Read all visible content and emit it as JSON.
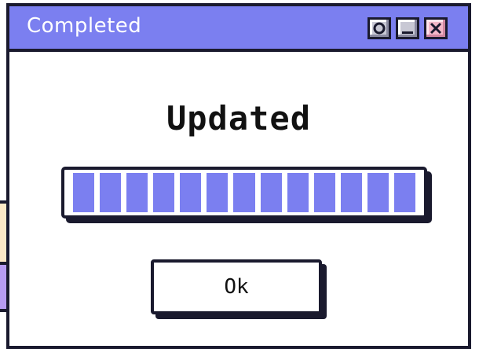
{
  "window": {
    "title": "Completed",
    "controls": {
      "help_icon": "circle-icon",
      "minimize_icon": "minimize-icon",
      "close_icon": "close-icon"
    }
  },
  "dialog": {
    "heading": "Updated",
    "progress": {
      "value": 1.0,
      "segments_filled": 13,
      "segments_total": 13
    },
    "ok_label": "Ok"
  },
  "colors": {
    "accent": "#7b7ff0",
    "outline": "#1a1a2e",
    "close_button": "#f3b7c8",
    "background_window_yellow": "#fde9c6",
    "background_window_purple": "#b79cf2"
  }
}
